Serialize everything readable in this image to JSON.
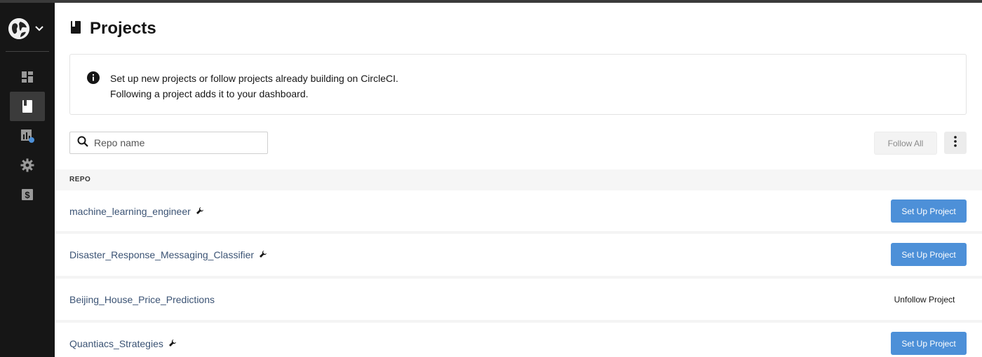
{
  "sidebar": {
    "org_avatar": "globe-avatar",
    "items": [
      {
        "name": "dashboard-icon"
      },
      {
        "name": "projects-icon",
        "active": true
      },
      {
        "name": "insights-icon"
      },
      {
        "name": "settings-icon"
      },
      {
        "name": "plan-icon"
      }
    ]
  },
  "page": {
    "title": "Projects"
  },
  "info": {
    "line1": "Set up new projects or follow projects already building on CircleCI.",
    "line2": "Following a project adds it to your dashboard."
  },
  "search": {
    "placeholder": "Repo name",
    "value": ""
  },
  "toolbar": {
    "follow_all_label": "Follow All"
  },
  "table": {
    "header": "REPO",
    "rows": [
      {
        "name": "machine_learning_engineer",
        "action": "Set Up Project",
        "wrench": true
      },
      {
        "name": "Disaster_Response_Messaging_Classifier",
        "action": "Set Up Project",
        "wrench": true
      },
      {
        "name": "Beijing_House_Price_Predictions",
        "action": "Unfollow Project",
        "wrench": false
      },
      {
        "name": "Quantiacs_Strategies",
        "action": "Set Up Project",
        "wrench": true
      }
    ]
  },
  "colors": {
    "sidebar_bg": "#161616",
    "primary_button": "#4d90d8",
    "repo_link": "#3b5374"
  }
}
